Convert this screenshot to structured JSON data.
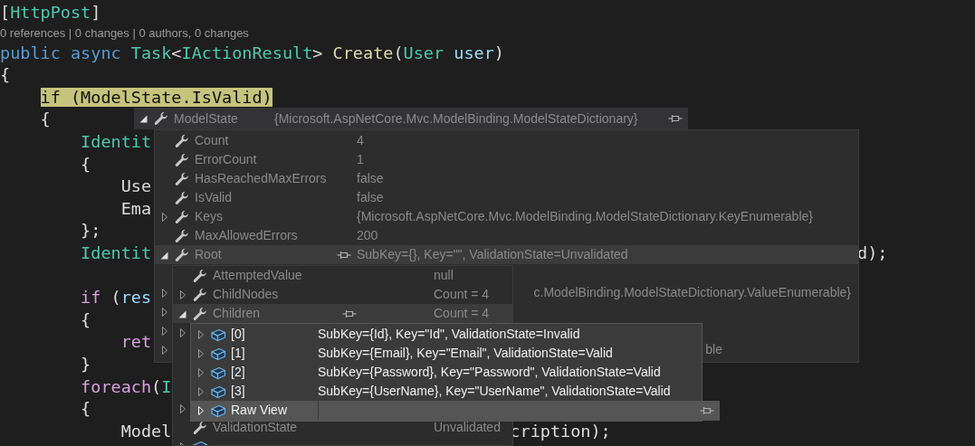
{
  "editor": {
    "lines": [
      {
        "kind": "code",
        "tokens": [
          {
            "text": "[",
            "kind": "plain"
          },
          {
            "text": "HttpPost",
            "kind": "type"
          },
          {
            "text": "]",
            "kind": "plain"
          }
        ]
      },
      {
        "kind": "codelens",
        "text": "0 references | 0 changes | 0 authors, 0 changes"
      },
      {
        "kind": "code",
        "tokens": [
          {
            "text": "public",
            "kind": "keyword"
          },
          {
            "text": " async",
            "kind": "keyword"
          },
          {
            "text": " Task",
            "kind": "type"
          },
          {
            "text": "<",
            "kind": "plain"
          },
          {
            "text": "IActionResult",
            "kind": "type"
          },
          {
            "text": ">",
            "kind": "plain"
          },
          {
            "text": " Create",
            "kind": "method"
          },
          {
            "text": "(",
            "kind": "plain"
          },
          {
            "text": "User",
            "kind": "type"
          },
          {
            "text": " user",
            "kind": "param"
          },
          {
            "text": ")",
            "kind": "plain"
          }
        ]
      },
      {
        "kind": "code",
        "tokens": [
          {
            "text": "{",
            "kind": "plain"
          }
        ]
      },
      {
        "kind": "code",
        "tokens": [
          {
            "text": "    if (ModelState.IsValid)",
            "kind": "highlight"
          }
        ]
      },
      {
        "kind": "code",
        "tokens": [
          {
            "text": "    {",
            "kind": "plain"
          }
        ]
      },
      {
        "kind": "code",
        "tokens": [
          {
            "text": "        Identit",
            "kind": "type"
          }
        ]
      },
      {
        "kind": "code",
        "tokens": [
          {
            "text": "        {",
            "kind": "plain"
          }
        ]
      },
      {
        "kind": "code",
        "tokens": [
          {
            "text": "            Use",
            "kind": "plain"
          }
        ]
      },
      {
        "kind": "code",
        "tokens": [
          {
            "text": "            Ema",
            "kind": "plain"
          }
        ]
      },
      {
        "kind": "code",
        "tokens": [
          {
            "text": "        };",
            "kind": "plain"
          }
        ]
      },
      {
        "kind": "code",
        "tokens": [
          {
            "text": "        Identit",
            "kind": "type"
          }
        ],
        "tail": "d);"
      },
      {
        "kind": "code"
      },
      {
        "kind": "code",
        "tokens": [
          {
            "text": "        if",
            "kind": "control"
          },
          {
            "text": " (",
            "kind": "plain"
          },
          {
            "text": "res",
            "kind": "param"
          }
        ]
      },
      {
        "kind": "code",
        "tokens": [
          {
            "text": "        {",
            "kind": "plain"
          }
        ]
      },
      {
        "kind": "code",
        "tokens": [
          {
            "text": "            ret",
            "kind": "control"
          }
        ]
      },
      {
        "kind": "code",
        "tokens": [
          {
            "text": "        }",
            "kind": "plain"
          }
        ]
      },
      {
        "kind": "code",
        "tokens": [
          {
            "text": "        foreach",
            "kind": "control"
          },
          {
            "text": "(",
            "kind": "plain"
          },
          {
            "text": "I",
            "kind": "type"
          }
        ]
      },
      {
        "kind": "code",
        "tokens": [
          {
            "text": "        {",
            "kind": "plain"
          }
        ]
      },
      {
        "kind": "code",
        "tokens": [
          {
            "text": "            Model",
            "kind": "plain"
          }
        ],
        "tail": "cription);"
      }
    ]
  },
  "datatips": [
    {
      "active": false,
      "header": {
        "kind": "property",
        "name": "ModelState",
        "value": "{Microsoft.AspNetCore.Mvc.ModelBinding.ModelStateDictionary}",
        "expanded": true,
        "pinned": true
      },
      "rows": [
        {
          "kind": "property",
          "name": "Count",
          "value": "4",
          "selected": false
        },
        {
          "kind": "property",
          "name": "ErrorCount",
          "value": "1",
          "selected": false
        },
        {
          "kind": "property",
          "name": "HasReachedMaxErrors",
          "value": "false",
          "selected": false
        },
        {
          "kind": "property",
          "name": "IsValid",
          "value": "false",
          "selected": false
        },
        {
          "kind": "property",
          "name": "Keys",
          "value": "{Microsoft.AspNetCore.Mvc.ModelBinding.ModelStateDictionary.KeyEnumerable}",
          "expanded": false,
          "selected": false
        },
        {
          "kind": "property",
          "name": "MaxAllowedErrors",
          "value": "200",
          "selected": false
        },
        {
          "kind": "property",
          "name": "Root",
          "value": "SubKey={}, Key=\"\", ValidationState=Unvalidated",
          "expanded": true,
          "pinned": true,
          "selected": true
        },
        {
          "kind": "hidden"
        },
        {
          "kind": "hidden",
          "value": "c.ModelBinding.ModelStateDictionary.ValueEnumerable}",
          "value_clipped": true,
          "expanded": false
        },
        {
          "kind": "hidden",
          "expanded": false
        },
        {
          "kind": "hidden",
          "expanded": false
        },
        {
          "kind": "hidden",
          "value": "ble",
          "value_clipped": true,
          "expanded": false
        }
      ]
    },
    {
      "active": false,
      "rows": [
        {
          "kind": "property",
          "name": "AttemptedValue",
          "value": "null",
          "selected": false
        },
        {
          "kind": "property",
          "name": "ChildNodes",
          "value": "Count = 4",
          "expanded": false,
          "selected": false
        },
        {
          "kind": "property",
          "name": "Children",
          "value": "Count = 4",
          "expanded": true,
          "pinned": true,
          "selected": true
        },
        {
          "kind": "hidden",
          "expanded": false
        },
        {
          "kind": "hidden"
        },
        {
          "kind": "hidden"
        },
        {
          "kind": "hidden"
        },
        {
          "kind": "hidden",
          "expanded": false
        },
        {
          "kind": "property",
          "name": "ValidationState",
          "value": "Unvalidated",
          "selected": false
        },
        {
          "kind": "object",
          "expanded": false,
          "selected": false
        }
      ]
    },
    {
      "active": true,
      "rows": [
        {
          "kind": "object",
          "name": "[0]",
          "value": "SubKey={Id}, Key=\"Id\", ValidationState=Invalid",
          "expanded": false,
          "selected": false
        },
        {
          "kind": "object",
          "name": "[1]",
          "value": "SubKey={Email}, Key=\"Email\", ValidationState=Valid",
          "expanded": false,
          "selected": false
        },
        {
          "kind": "object",
          "name": "[2]",
          "value": "SubKey={Password}, Key=\"Password\", ValidationState=Valid",
          "expanded": false,
          "selected": false
        },
        {
          "kind": "object",
          "name": "[3]",
          "value": "SubKey={UserName}, Key=\"UserName\", ValidationState=Valid",
          "expanded": false,
          "selected": false
        },
        {
          "kind": "object",
          "name": "Raw View",
          "expanded": false,
          "pinned": true,
          "selected": true
        }
      ]
    }
  ]
}
